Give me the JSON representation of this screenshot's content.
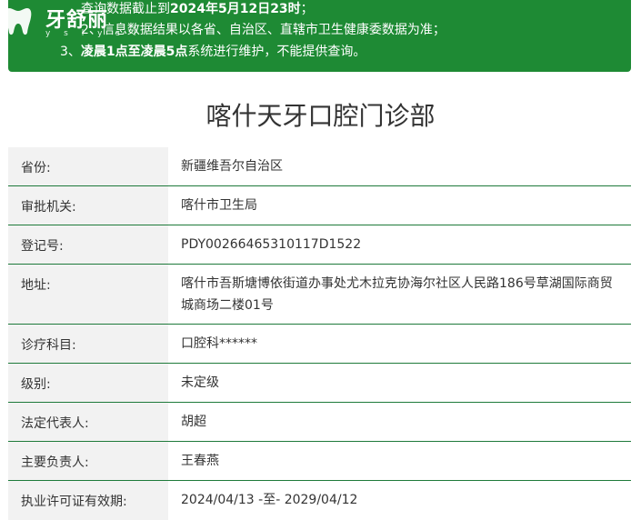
{
  "notice": {
    "line1_prefix": "查询数据截止到",
    "line1_bold": "2024年5月12日23时",
    "line1_suffix": "；",
    "line2": "2、信息数据结果以各省、自治区、直辖市卫生健康委数据为准；",
    "line3_prefix": "3、",
    "line3_bold": "凌晨1点至凌晨5点",
    "line3_suffix": "系统进行维护，不能提供查询。",
    "bg_color": "#1e8a34"
  },
  "logo": {
    "brand": "牙舒丽",
    "sub": "y s l y s l"
  },
  "page_title": "喀什天牙口腔门诊部",
  "rows": [
    {
      "label": "省份:",
      "value": "新疆维吾尔自治区"
    },
    {
      "label": "审批机关:",
      "value": "喀什市卫生局"
    },
    {
      "label": "登记号:",
      "value": "PDY00266465310117D1522"
    },
    {
      "label": "地址:",
      "value": "喀什市吾斯塘博依街道办事处尤木拉克协海尔社区人民路186号草湖国际商贸城商场二楼01号"
    },
    {
      "label": "诊疗科目:",
      "value": "口腔科******"
    },
    {
      "label": "级别:",
      "value": "未定级"
    },
    {
      "label": "法定代表人:",
      "value": "胡超"
    },
    {
      "label": "主要负责人:",
      "value": "王春燕"
    },
    {
      "label": "执业许可证有效期:",
      "value": "2024/04/13 -至- 2029/04/12"
    }
  ],
  "accent_color": "#1e7a3a"
}
